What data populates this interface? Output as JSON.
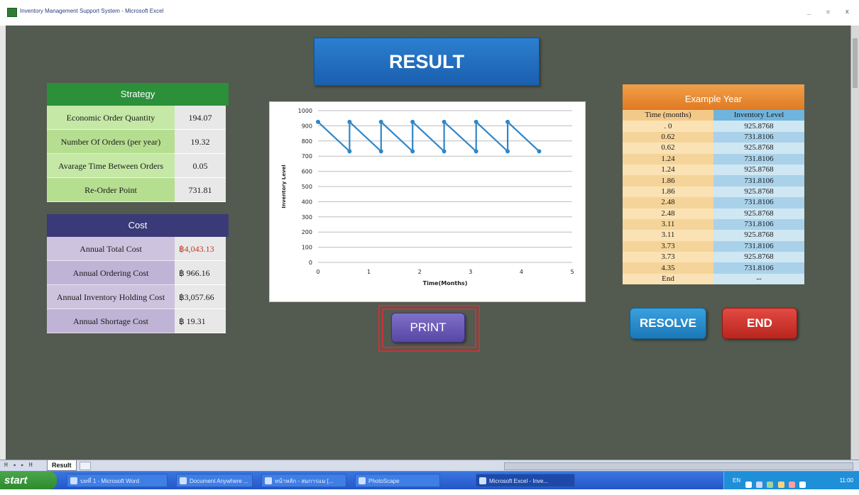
{
  "window": {
    "title": "Inventory Management Support System - Microsoft Excel",
    "controls": "_ ▫ x"
  },
  "result_title": "RESULT",
  "strategy": {
    "header": "Strategy",
    "rows": [
      {
        "label": "Economic Order Quantity",
        "value": "194.07"
      },
      {
        "label": "Number Of Orders (per year)",
        "value": "19.32"
      },
      {
        "label": "Avarage Time Between Orders",
        "value": "0.05"
      },
      {
        "label": "Re-Order Point",
        "value": "731.81"
      }
    ]
  },
  "cost": {
    "header": "Cost",
    "rows": [
      {
        "label": "Annual Total Cost",
        "value": "฿4,043.13"
      },
      {
        "label": "Annual Ordering Cost",
        "value": "฿  966.16"
      },
      {
        "label": "Annual Inventory Holding Cost",
        "value": "฿3,057.66"
      },
      {
        "label": "Annual Shortage Cost",
        "value": "฿    19.31"
      }
    ],
    "highlight_color": "#c8381f"
  },
  "chart_data": {
    "type": "line",
    "title": "",
    "xlabel": "Time(Months)",
    "ylabel": "Inventory Level",
    "xlim": [
      0,
      5
    ],
    "ylim": [
      0,
      1000
    ],
    "xticks": [
      0,
      1,
      2,
      3,
      4,
      5
    ],
    "yticks": [
      0,
      100,
      200,
      300,
      400,
      500,
      600,
      700,
      800,
      900,
      1000
    ],
    "grid": true,
    "series": [
      {
        "color": "#2f86c8",
        "x": [
          0,
          0.62,
          0.62,
          1.24,
          1.24,
          1.86,
          1.86,
          2.48,
          2.48,
          3.11,
          3.11,
          3.73,
          3.73,
          4.35
        ],
        "y": [
          925.8768,
          731.8106,
          925.8768,
          731.8106,
          925.8768,
          731.8106,
          925.8768,
          731.8106,
          925.8768,
          731.8106,
          925.8768,
          731.8106,
          925.8768,
          731.8106
        ]
      }
    ]
  },
  "buttons": {
    "print": "PRINT",
    "resolve": "RESOLVE",
    "end": "END"
  },
  "example_year": {
    "header": "Example Year",
    "columns": [
      "Time (months)",
      "Inventory Level"
    ],
    "rows": [
      [
        ". 0",
        "925.8768"
      ],
      [
        "0.62",
        "731.8106"
      ],
      [
        "0.62",
        "925.8768"
      ],
      [
        "1.24",
        "731.8106"
      ],
      [
        "1.24",
        "925.8768"
      ],
      [
        "1.86",
        "731.8106"
      ],
      [
        "1.86",
        "925.8768"
      ],
      [
        "2.48",
        "731.8106"
      ],
      [
        "2.48",
        "925.8768"
      ],
      [
        "3.11",
        "731.8106"
      ],
      [
        "3.11",
        "925.8768"
      ],
      [
        "3.73",
        "731.8106"
      ],
      [
        "3.73",
        "925.8768"
      ],
      [
        "4.35",
        "731.8106"
      ],
      [
        "End",
        "--"
      ]
    ]
  },
  "sheet_tabs": {
    "nav": "H ◂ ▸ H",
    "active": "Result"
  },
  "taskbar": {
    "start": "start",
    "tasks": [
      "บทที่ 1 - Microsoft Word",
      "Document Anywhere ...",
      "หน้าหลัก - สมการแม [...",
      "PhotoScape",
      "Microsoft Excel - Inve..."
    ],
    "tray_lang": "EN",
    "clock": "11:00"
  }
}
